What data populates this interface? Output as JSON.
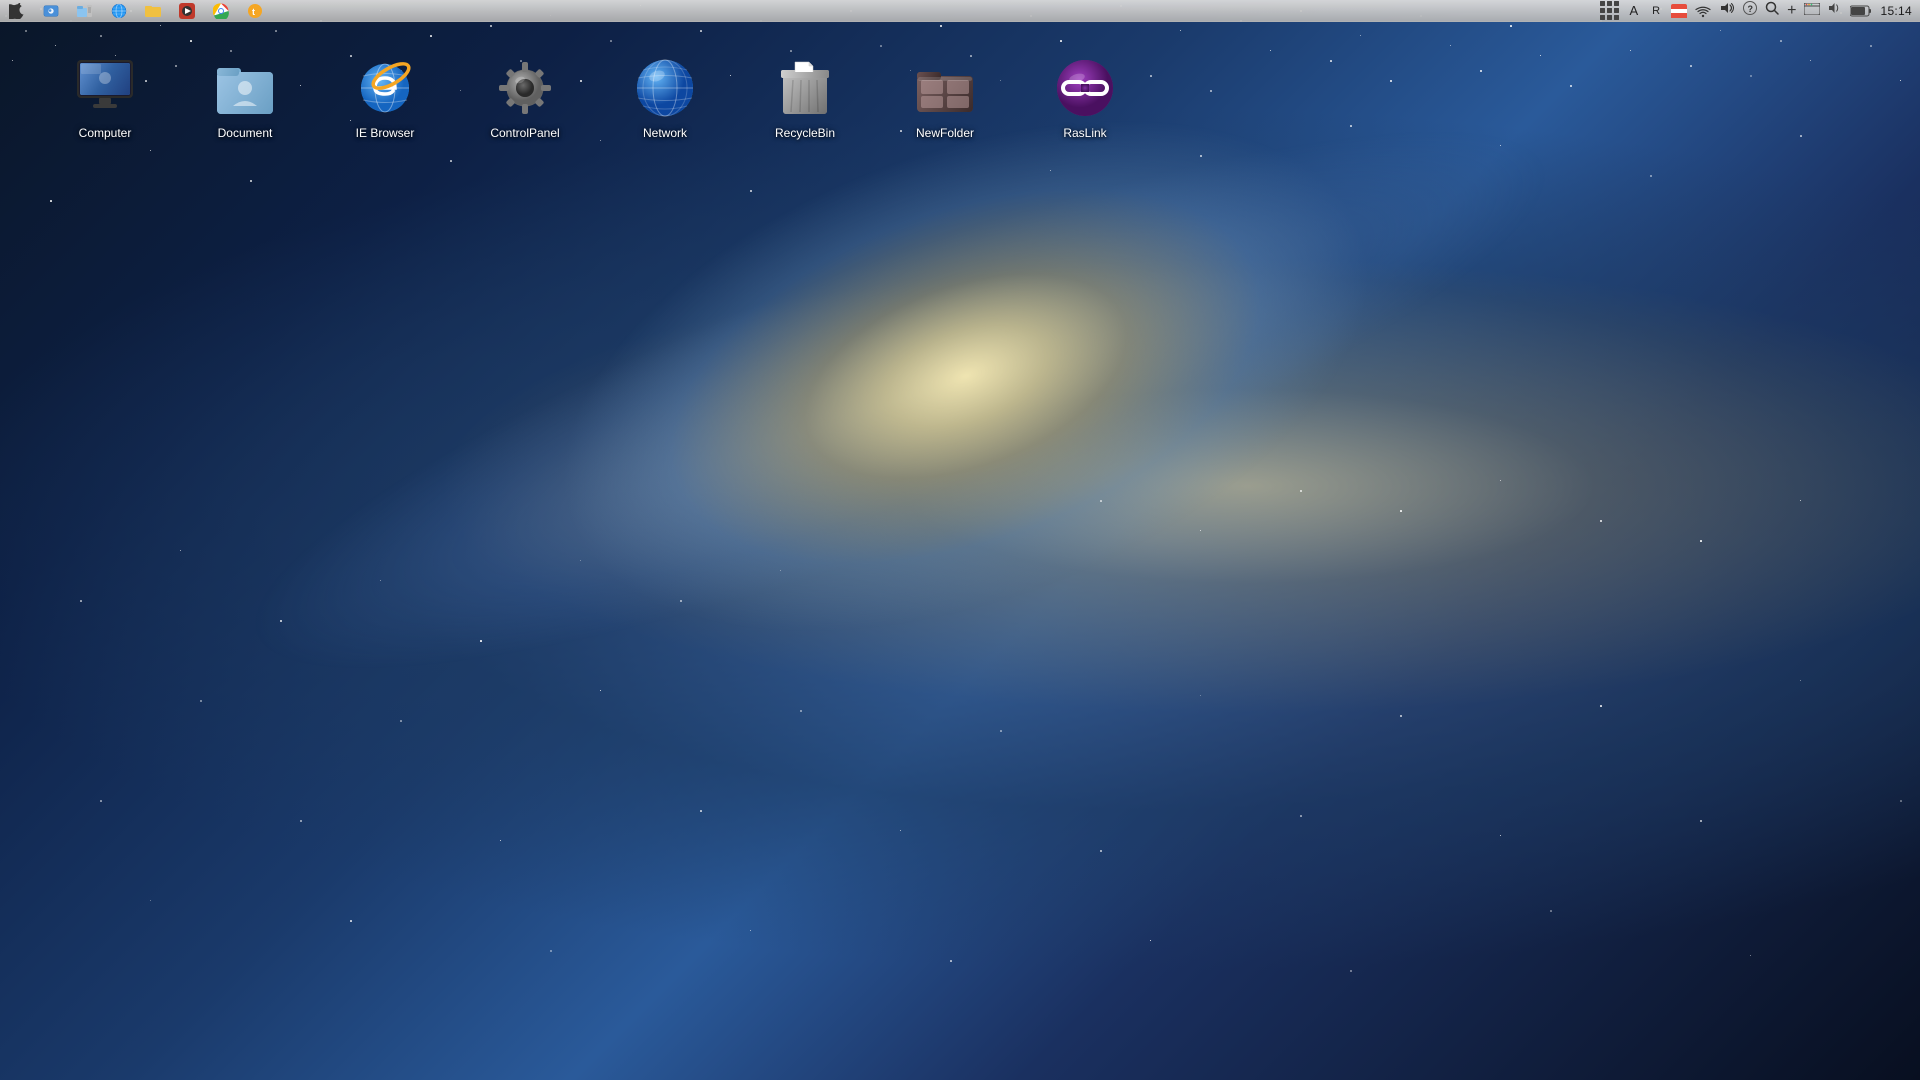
{
  "wallpaper": {
    "description": "macOS galaxy/milky way wallpaper"
  },
  "menubar": {
    "apple_symbol": "",
    "left_icons": [
      "finder",
      "file-manager",
      "globe",
      "folder",
      "media-player",
      "chrome",
      "telegram"
    ],
    "time": "15:14",
    "right_icons": [
      "grid-menu",
      "A-icon",
      "R-icon",
      "language-icon",
      "wifi-icon",
      "sound-icon",
      "question-icon",
      "search-icon",
      "plus-icon",
      "window-icon",
      "volume-icon",
      "battery-icon"
    ]
  },
  "desktop": {
    "icons": [
      {
        "id": "computer",
        "label": "Computer"
      },
      {
        "id": "document",
        "label": "Document"
      },
      {
        "id": "ie-browser",
        "label": "IE Browser"
      },
      {
        "id": "control-panel",
        "label": "ControlPanel"
      },
      {
        "id": "network",
        "label": "Network"
      },
      {
        "id": "recycle-bin",
        "label": "RecycleBin"
      },
      {
        "id": "new-folder",
        "label": "NewFolder"
      },
      {
        "id": "raslink",
        "label": "RasLink"
      }
    ]
  }
}
